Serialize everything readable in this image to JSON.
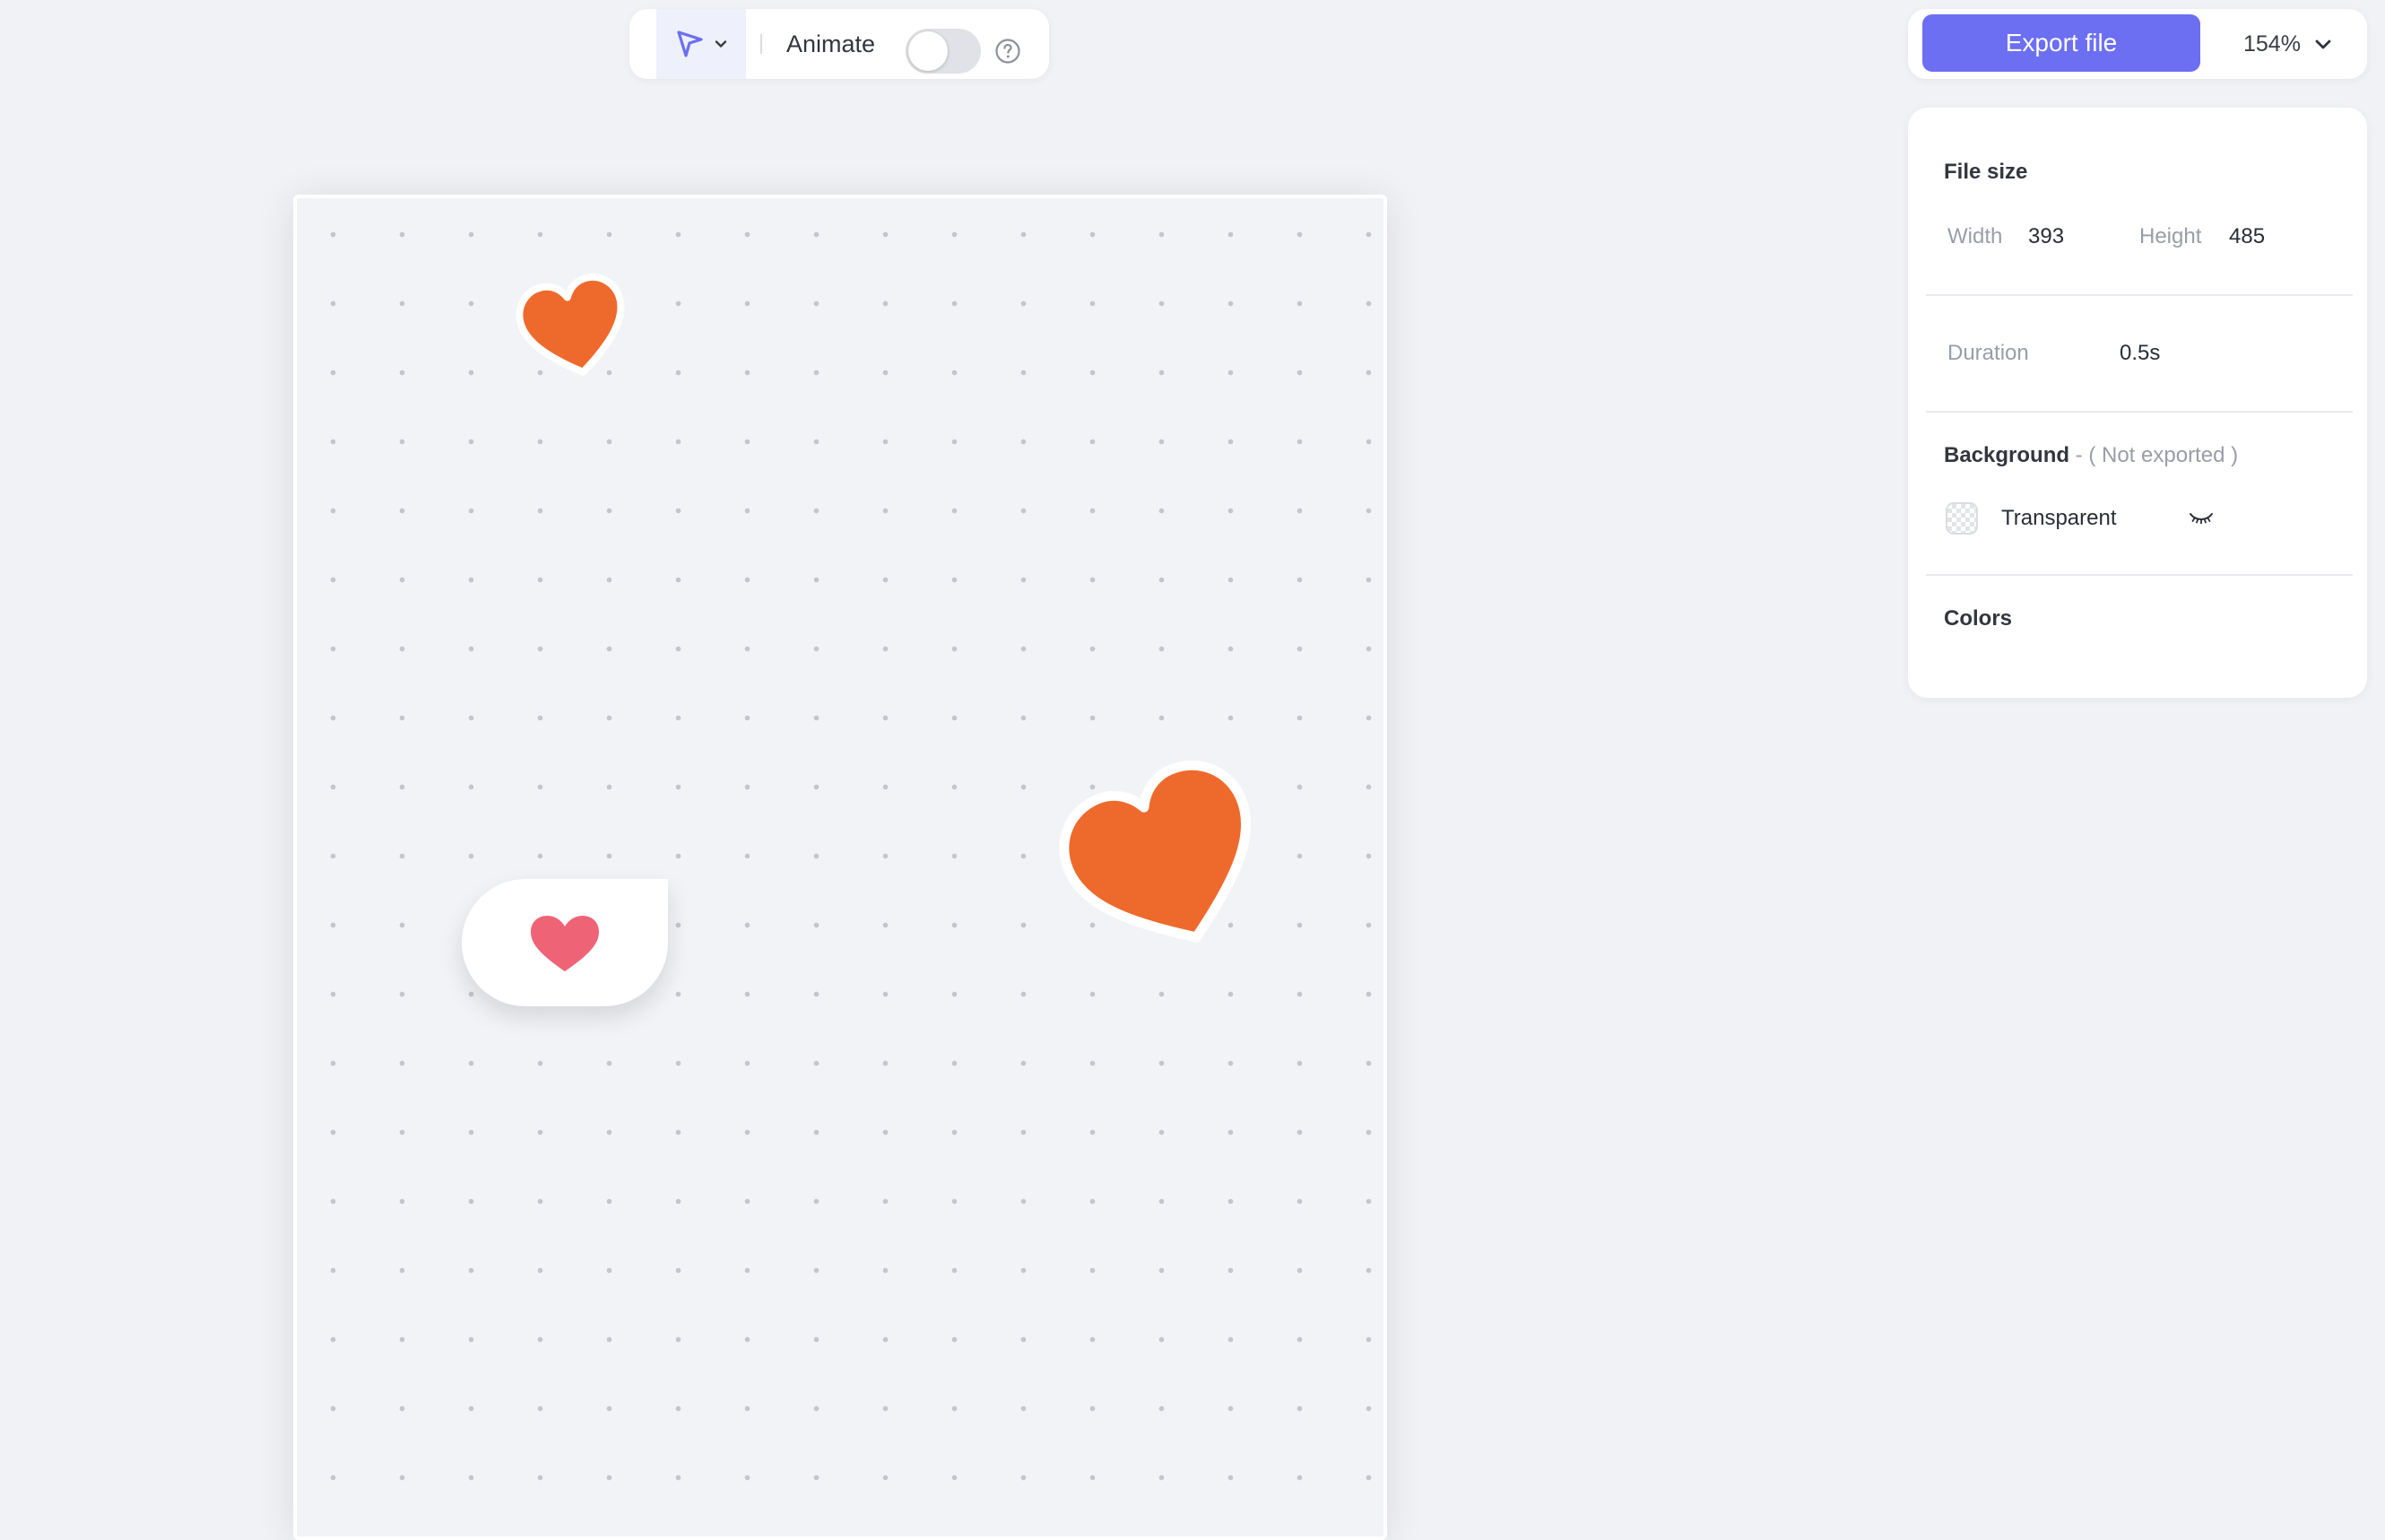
{
  "toolbar": {
    "tool_icon": "pointer-icon",
    "animate_label": "Animate",
    "animate_enabled": false,
    "help_icon": "help-circle-icon"
  },
  "export": {
    "button_label": "Export file",
    "zoom_value": "154%"
  },
  "panel": {
    "file_size": {
      "title": "File size",
      "width_label": "Width",
      "width_value": "393",
      "height_label": "Height",
      "height_value": "485"
    },
    "duration": {
      "label": "Duration",
      "value": "0.5s"
    },
    "background": {
      "title": "Background",
      "note": " - ( Not exported )",
      "value": "Transparent",
      "visibility_icon": "eye-closed-icon"
    },
    "colors": {
      "title": "Colors"
    }
  },
  "canvas": {
    "stickers": [
      {
        "name": "small-orange-heart",
        "color": "#ee6a2c"
      },
      {
        "name": "large-orange-heart",
        "color": "#ee6a2c"
      },
      {
        "name": "heart-bubble",
        "color": "#ef6377"
      }
    ]
  },
  "colors": {
    "accent": "#6c6ff2",
    "heart_orange": "#ee6a2c",
    "heart_pink": "#ef6377"
  }
}
